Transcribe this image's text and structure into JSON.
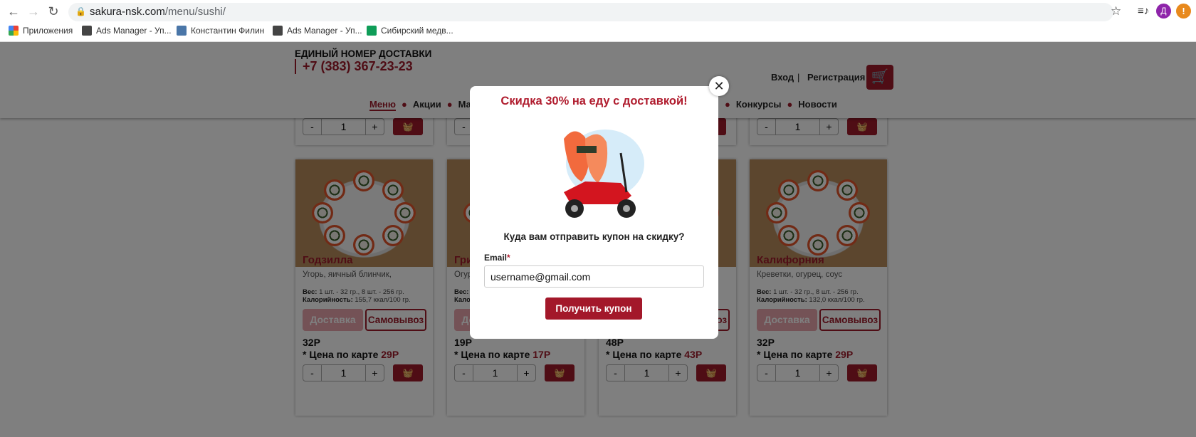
{
  "browser": {
    "url_host": "sakura-nsk.com",
    "url_path": "/menu/sushi/",
    "profile_initial": "Д",
    "bookmarks": [
      {
        "label": "Приложения",
        "icon": "apps-grid-icon"
      },
      {
        "label": "Ads Manager - Уп...",
        "icon": "ads-icon"
      },
      {
        "label": "Константин Филин",
        "icon": "vk-icon"
      },
      {
        "label": "Ads Manager - Уп...",
        "icon": "ads-icon"
      },
      {
        "label": "Сибирский медв...",
        "icon": "sheets-icon"
      }
    ]
  },
  "header": {
    "delivery_label": "ЕДИНЫЙ НОМЕР ДОСТАВКИ",
    "phone": "+7 (383) 367-23-23",
    "login": "Вход",
    "separator": "|",
    "register": "Регистрация"
  },
  "nav": {
    "items": [
      "Меню",
      "Акции",
      "Магаз",
      "Конкурсы",
      "Новости"
    ]
  },
  "colors": {
    "brand": "#9e1a2a",
    "overlay": "rgba(0,0,0,0.5)"
  },
  "cards_top": [
    {
      "qty": "1"
    },
    {
      "qty": "1"
    },
    {
      "qty": "1"
    },
    {
      "qty": "1"
    }
  ],
  "cards": [
    {
      "name": "Годзилла",
      "desc": "Угорь, яичный блинчик,",
      "weight_label": "Вес:",
      "weight": "1 шт. - 32 гр., 8 шт. - 256 гр.",
      "cal_label": "Калорийность:",
      "cal": "155,7 ккал/100 гр.",
      "delivery": "Доставка",
      "pickup": "Самовывоз",
      "price": "32Р",
      "card_price_label": "* Цена по карте",
      "card_price": "29Р",
      "qty": "1"
    },
    {
      "name": "Гри",
      "desc": "Огур",
      "weight_label": "Вес:",
      "weight": "",
      "cal_label": "Калор",
      "cal": "",
      "delivery": "Доставка",
      "pickup": "Самовывоз",
      "price": "19Р",
      "card_price_label": "* Цена по карте",
      "card_price": "17Р",
      "qty": "1"
    },
    {
      "name": "",
      "desc": "",
      "weight_label": "",
      "weight": "",
      "cal_label": "",
      "cal": "",
      "delivery": "Доставка",
      "pickup": "Самовывоз",
      "price": "48Р",
      "card_price_label": "* Цена по карте",
      "card_price": "43Р",
      "qty": "1"
    },
    {
      "name": "Калифорния",
      "desc": "Креветки, огурец, соус",
      "weight_label": "Вес:",
      "weight": "1 шт. - 32 гр., 8 шт. - 256 гр.",
      "cal_label": "Калорийность:",
      "cal": "132,0 ккал/100 гр.",
      "delivery": "Доставка",
      "pickup": "Самовывоз",
      "price": "32Р",
      "card_price_label": "* Цена по карте",
      "card_price": "29Р",
      "qty": "1"
    }
  ],
  "popup": {
    "title": "Скидка 30% на еду с доставкой!",
    "question": "Куда вам отправить купон на скидку?",
    "email_label": "Email",
    "required_mark": "*",
    "email_value": "username@gmail.com",
    "submit": "Получить купон",
    "close": "✕"
  }
}
